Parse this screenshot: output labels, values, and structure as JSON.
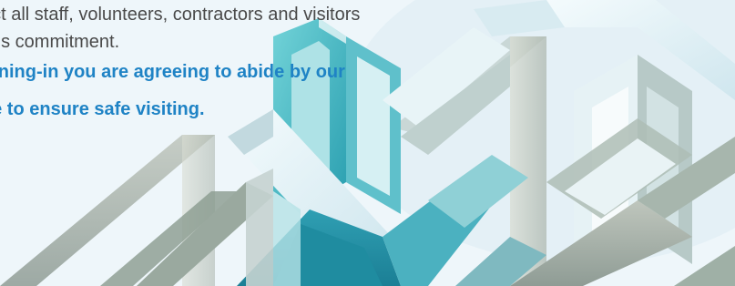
{
  "notice": {
    "line1": "ect all staff, volunteers, contractors and visitors",
    "line2": " this commitment.",
    "line3": "igning-in you are agreeing to abide by our",
    "line4": "ce to ensure safe visiting."
  },
  "artwork": {
    "icon": "impossible-lattice-illustration",
    "colors": {
      "teal": "#3fbec6",
      "light_teal": "#9fdbe0",
      "pale_blue": "#dceff4",
      "grey_sage": "#a5b1a9",
      "text_grey": "#4a4a4a",
      "accent_blue": "#1f83c5"
    }
  }
}
